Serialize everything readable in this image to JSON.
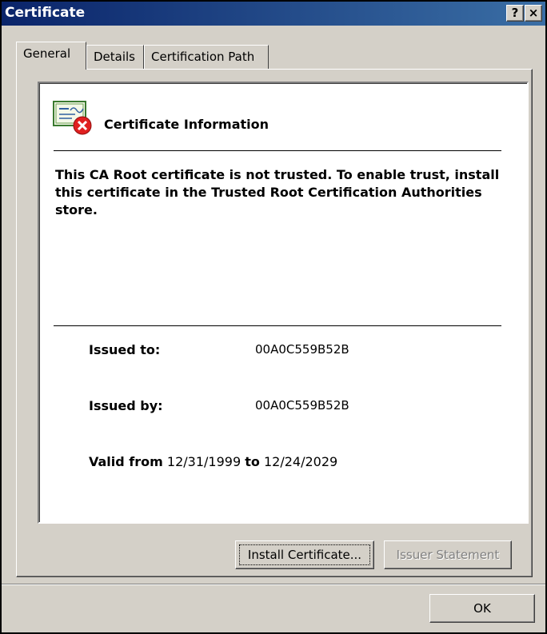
{
  "window": {
    "title": "Certificate",
    "help_glyph": "?",
    "close_glyph": "×"
  },
  "tabs": [
    {
      "label": "General",
      "active": true
    },
    {
      "label": "Details",
      "active": false
    },
    {
      "label": "Certification Path",
      "active": false
    }
  ],
  "info": {
    "icon": "certificate-error-icon",
    "title": "Certificate Information",
    "message": "This CA Root certificate is not trusted. To enable trust, install this certificate in the Trusted Root Certification Authorities store.",
    "issued_to_label": "Issued to:",
    "issued_to_value": "00A0C559B52B",
    "issued_by_label": "Issued by:",
    "issued_by_value": "00A0C559B52B",
    "valid_from_label": "Valid from",
    "valid_from_value": "12/31/1999",
    "valid_to_label": "to",
    "valid_to_value": "12/24/2029"
  },
  "buttons": {
    "install": "Install Certificate...",
    "issuer": "Issuer Statement",
    "ok": "OK"
  },
  "colors": {
    "titlebar_start": "#0a246a",
    "titlebar_end": "#3a6ea5",
    "dialog_bg": "#d4d0c8",
    "error_red": "#e02020"
  }
}
